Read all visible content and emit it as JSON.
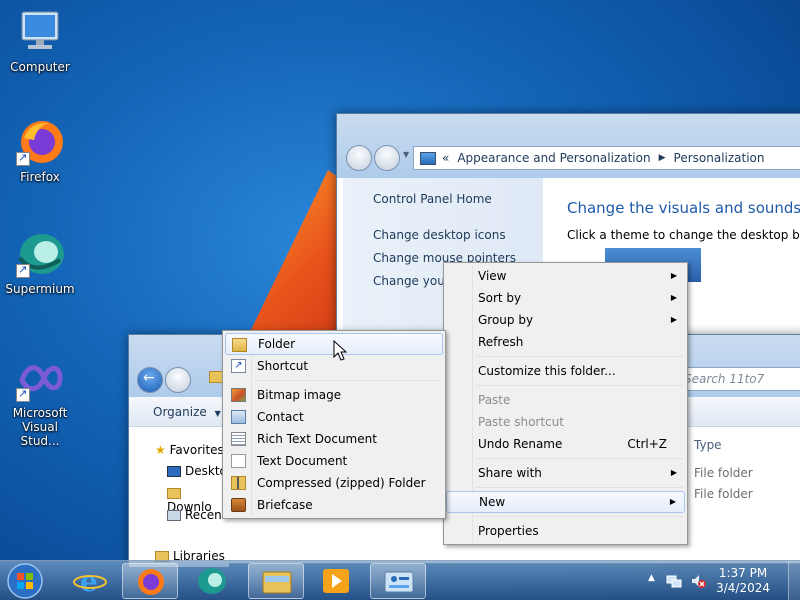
{
  "desktop": {
    "icons": [
      {
        "label": "Computer",
        "icon": "computer-icon"
      },
      {
        "label": "Firefox",
        "icon": "firefox-icon"
      },
      {
        "label": "Supermium",
        "icon": "supermium-icon"
      },
      {
        "label": "Microsoft Visual Stud...",
        "icon": "visual-studio-icon"
      }
    ]
  },
  "control_panel": {
    "breadcrumb_overflow": "«",
    "breadcrumb": [
      "Appearance and Personalization",
      "Personalization"
    ],
    "left_links": [
      "Control Panel Home",
      "Change desktop icons",
      "Change mouse pointers",
      "Change your"
    ],
    "heading": "Change the visuals and sounds on",
    "subtext": "Click a theme to change the desktop backgr"
  },
  "explorer": {
    "search_placeholder": "Search 11to7",
    "organize_label": "Organize",
    "nav": {
      "favorites": "Favorites",
      "items": [
        "Deskto",
        "Downlo",
        "Recent"
      ],
      "libraries": "Libraries"
    },
    "columns": {
      "type": "Type"
    },
    "rows": [
      {
        "type": "File folder"
      },
      {
        "type": "File folder"
      }
    ]
  },
  "context_menu": {
    "items": [
      {
        "label": "View",
        "submenu": true
      },
      {
        "label": "Sort by",
        "submenu": true
      },
      {
        "label": "Group by",
        "submenu": true
      },
      {
        "label": "Refresh"
      },
      {
        "sep": true
      },
      {
        "label": "Customize this folder..."
      },
      {
        "sep": true
      },
      {
        "label": "Paste",
        "disabled": true
      },
      {
        "label": "Paste shortcut",
        "disabled": true
      },
      {
        "label": "Undo Rename",
        "shortcut": "Ctrl+Z"
      },
      {
        "sep": true
      },
      {
        "label": "Share with",
        "submenu": true
      },
      {
        "sep": true
      },
      {
        "label": "New",
        "submenu": true,
        "highlighted": true
      },
      {
        "sep": true
      },
      {
        "label": "Properties"
      }
    ]
  },
  "new_submenu": {
    "items": [
      {
        "label": "Folder",
        "icon": "folder-icon",
        "highlighted": true
      },
      {
        "label": "Shortcut",
        "icon": "shortcut-icon"
      },
      {
        "sep": true
      },
      {
        "label": "Bitmap image",
        "icon": "bitmap-icon"
      },
      {
        "label": "Contact",
        "icon": "contact-icon"
      },
      {
        "label": "Rich Text Document",
        "icon": "rtf-icon"
      },
      {
        "label": "Text Document",
        "icon": "text-document-icon"
      },
      {
        "label": "Compressed (zipped) Folder",
        "icon": "zip-folder-icon"
      },
      {
        "label": "Briefcase",
        "icon": "briefcase-icon"
      }
    ]
  },
  "taskbar": {
    "buttons": [
      "start-orb",
      "internet-explorer",
      "firefox",
      "supermium",
      "windows-explorer",
      "media-player",
      "control-panel"
    ],
    "clock": {
      "time": "1:37 PM",
      "date": "3/4/2024"
    },
    "tray": [
      "show-hidden-icons",
      "network-icon",
      "volume-muted-icon"
    ]
  },
  "colors": {
    "desktop_bg": "#1465b8",
    "link": "#1e395b",
    "heading": "#1e5aa8",
    "menu_bg": "#f0f0f0",
    "highlight_border": "#a9c6ec"
  }
}
